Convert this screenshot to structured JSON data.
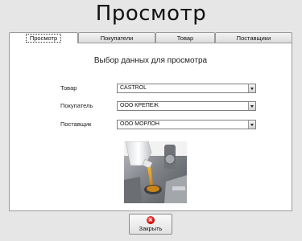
{
  "window": {
    "title": "Просмотр"
  },
  "tabs": [
    {
      "label": "Просмотр",
      "active": true
    },
    {
      "label": "Покупатели",
      "active": false
    },
    {
      "label": "Товар",
      "active": false
    },
    {
      "label": "Поставщики",
      "active": false
    }
  ],
  "panel": {
    "heading": "Выбор данных для просмотра",
    "fields": [
      {
        "label": "Товар",
        "value": "CASTROL"
      },
      {
        "label": "Покупатель",
        "value": "ООО КРЕПЕЖ"
      },
      {
        "label": "Поставщик",
        "value": "ООО МОРЛОН"
      }
    ],
    "image_icon": "product-photo"
  },
  "footer": {
    "close_label": "Закрыть",
    "close_icon": "close-icon"
  },
  "colors": {
    "background": "#e6e6e6",
    "panel": "#ffffff",
    "close_icon": "#d00000"
  }
}
